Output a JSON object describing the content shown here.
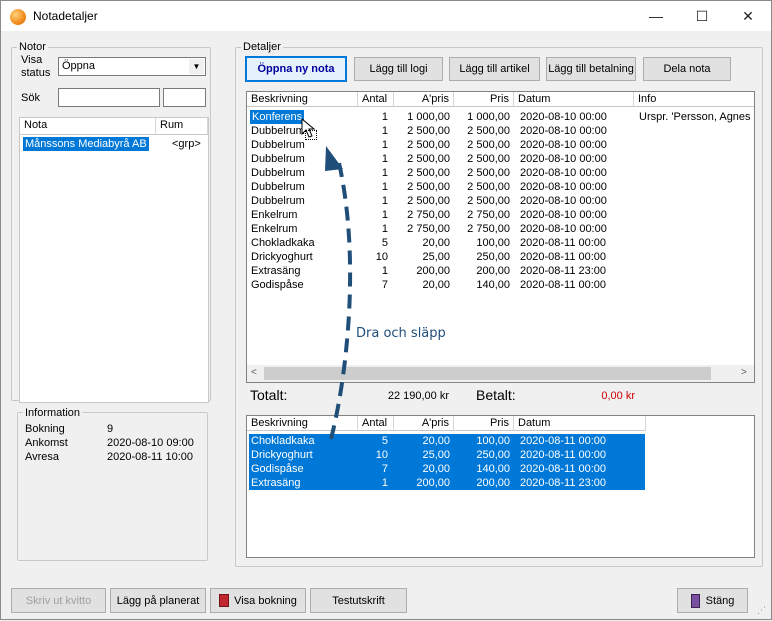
{
  "window": {
    "title": "Notadetaljer",
    "controls": {
      "minimize": "—",
      "maximize": "☐",
      "close": "✕"
    }
  },
  "notor": {
    "group_label": "Notor",
    "visa_status_label_1": "Visa",
    "visa_status_label_2": "status",
    "status_value": "Öppna",
    "search_label": "Sök",
    "search_value": "",
    "search2_value": "",
    "list_headers": [
      "Nota",
      "Rum"
    ],
    "list_rows": [
      {
        "nota": "Månssons Mediabyrå AB",
        "rum": "<grp>"
      }
    ]
  },
  "information": {
    "group_label": "Information",
    "rows": [
      {
        "label": "Bokning",
        "value": "9"
      },
      {
        "label": "Ankomst",
        "value": "2020-08-10 09:00"
      },
      {
        "label": "Avresa",
        "value": "2020-08-11 10:00"
      }
    ]
  },
  "detaljer": {
    "group_label": "Detaljer",
    "buttons": [
      "Öppna ny nota",
      "Lägg till logi",
      "Lägg till artikel",
      "Lägg till betalning",
      "Dela nota"
    ],
    "headers": [
      "Beskrivning",
      "Antal",
      "A'pris",
      "Pris",
      "Datum",
      "Info"
    ],
    "rows": [
      {
        "desc": "Konferens",
        "antal": "1",
        "apris": "1 000,00",
        "pris": "1 000,00",
        "datum": "2020-08-10 00:00",
        "info": "Urspr. 'Persson, Agnes ("
      },
      {
        "desc": "Dubbelrum",
        "antal": "1",
        "apris": "2 500,00",
        "pris": "2 500,00",
        "datum": "2020-08-10 00:00",
        "info": ""
      },
      {
        "desc": "Dubbelrum",
        "antal": "1",
        "apris": "2 500,00",
        "pris": "2 500,00",
        "datum": "2020-08-10 00:00",
        "info": ""
      },
      {
        "desc": "Dubbelrum",
        "antal": "1",
        "apris": "2 500,00",
        "pris": "2 500,00",
        "datum": "2020-08-10 00:00",
        "info": ""
      },
      {
        "desc": "Dubbelrum",
        "antal": "1",
        "apris": "2 500,00",
        "pris": "2 500,00",
        "datum": "2020-08-10 00:00",
        "info": ""
      },
      {
        "desc": "Dubbelrum",
        "antal": "1",
        "apris": "2 500,00",
        "pris": "2 500,00",
        "datum": "2020-08-10 00:00",
        "info": ""
      },
      {
        "desc": "Dubbelrum",
        "antal": "1",
        "apris": "2 500,00",
        "pris": "2 500,00",
        "datum": "2020-08-10 00:00",
        "info": ""
      },
      {
        "desc": "Enkelrum",
        "antal": "1",
        "apris": "2 750,00",
        "pris": "2 750,00",
        "datum": "2020-08-10 00:00",
        "info": ""
      },
      {
        "desc": "Enkelrum",
        "antal": "1",
        "apris": "2 750,00",
        "pris": "2 750,00",
        "datum": "2020-08-10 00:00",
        "info": ""
      },
      {
        "desc": "Chokladkaka",
        "antal": "5",
        "apris": "20,00",
        "pris": "100,00",
        "datum": "2020-08-11 00:00",
        "info": ""
      },
      {
        "desc": "Drickyoghurt",
        "antal": "10",
        "apris": "25,00",
        "pris": "250,00",
        "datum": "2020-08-11 00:00",
        "info": ""
      },
      {
        "desc": "Extrasäng",
        "antal": "1",
        "apris": "200,00",
        "pris": "200,00",
        "datum": "2020-08-11 23:00",
        "info": ""
      },
      {
        "desc": "Godispåse",
        "antal": "7",
        "apris": "20,00",
        "pris": "140,00",
        "datum": "2020-08-11 00:00",
        "info": ""
      }
    ],
    "totals": {
      "total_label": "Totalt:",
      "total_value": "22 190,00 kr",
      "paid_label": "Betalt:",
      "paid_value": "0,00 kr"
    },
    "lower_headers": [
      "Beskrivning",
      "Antal",
      "A'pris",
      "Pris",
      "Datum"
    ],
    "lower_rows": [
      {
        "desc": "Chokladkaka",
        "antal": "5",
        "apris": "20,00",
        "pris": "100,00",
        "datum": "2020-08-11 00:00"
      },
      {
        "desc": "Drickyoghurt",
        "antal": "10",
        "apris": "25,00",
        "pris": "250,00",
        "datum": "2020-08-11 00:00"
      },
      {
        "desc": "Godispåse",
        "antal": "7",
        "apris": "20,00",
        "pris": "140,00",
        "datum": "2020-08-11 00:00"
      },
      {
        "desc": "Extrasäng",
        "antal": "1",
        "apris": "200,00",
        "pris": "200,00",
        "datum": "2020-08-11 23:00"
      }
    ]
  },
  "annotation": {
    "text": "Dra och släpp",
    "color": "#1f4e79"
  },
  "bottom_buttons": [
    "Skriv ut kvitto",
    "Lägg på planerat",
    "Visa bokning",
    "Testutskrift",
    "Stäng"
  ],
  "colors": {
    "accent": "#0078d7",
    "paid": "#d00000"
  }
}
